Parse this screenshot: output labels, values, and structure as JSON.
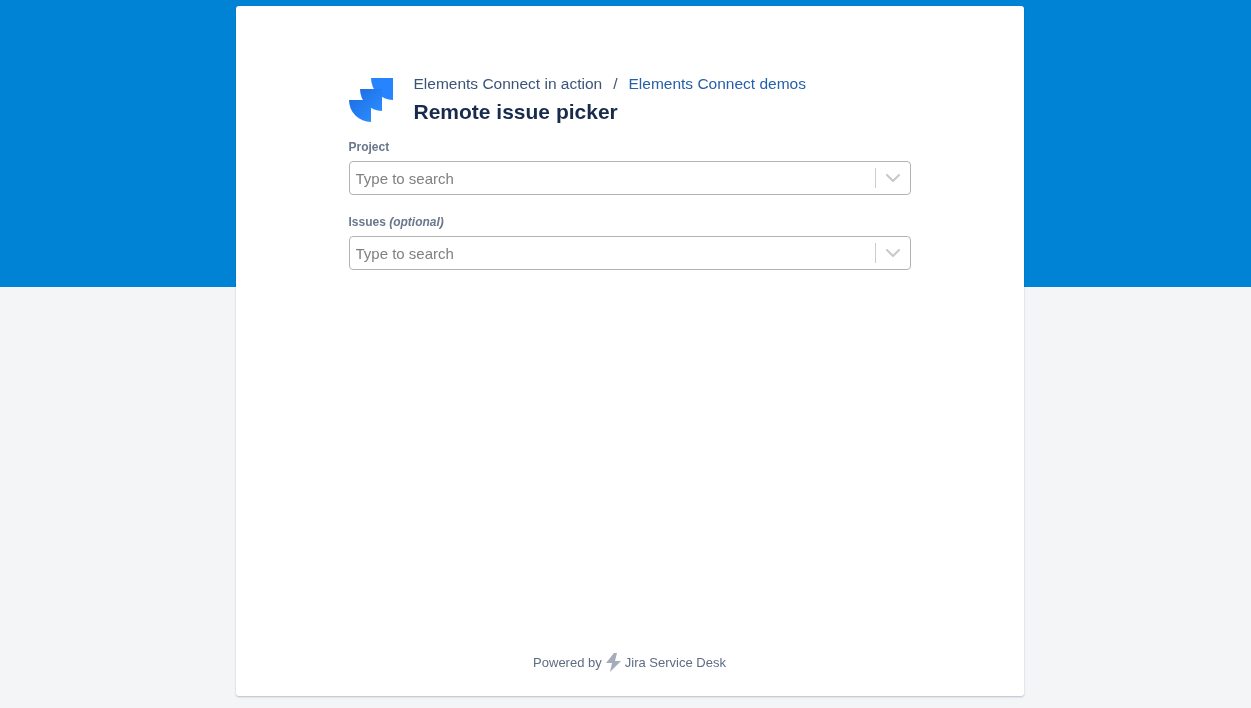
{
  "breadcrumbs": {
    "items": [
      "Elements Connect in action",
      "Elements Connect demos"
    ],
    "separator": "/"
  },
  "title": "Remote issue picker",
  "fields": [
    {
      "label": "Project",
      "placeholder": "Type to search"
    },
    {
      "label": "Issues *(optional)*",
      "placeholder": "Type to search"
    }
  ],
  "footer": {
    "prefix": "Powered by",
    "product": "Jira Service Desk"
  }
}
